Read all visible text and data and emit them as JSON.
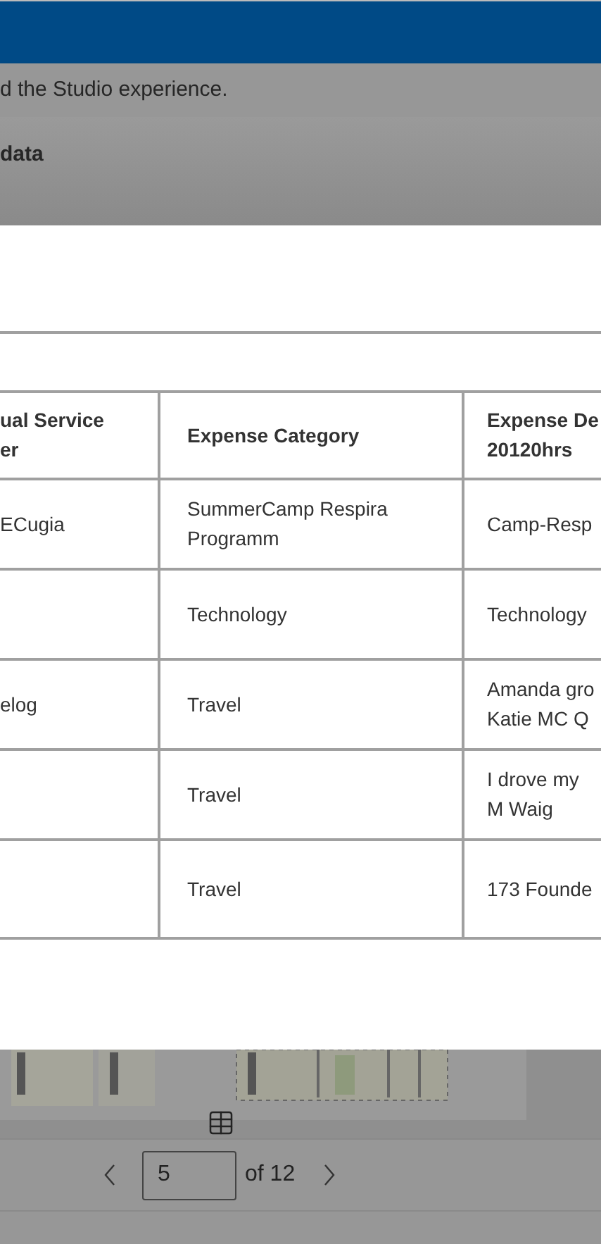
{
  "notice": {
    "text": "d the Studio experience."
  },
  "panel_header": {
    "title": "data"
  },
  "table": {
    "columns": [
      "ual Service\ner",
      "Expense Category",
      "Expense De\n20120hrs"
    ],
    "rows": [
      {
        "cells": [
          "ECugia",
          "SummerCamp Respira\nProgramm",
          "Camp-Resp"
        ]
      },
      {
        "cells": [
          "",
          "Technology",
          "Technology"
        ]
      },
      {
        "cells": [
          "elog",
          "Travel",
          "Amanda gro\nKatie MC Q"
        ]
      },
      {
        "cells": [
          "",
          "Travel",
          "I drove my\nM Waig"
        ]
      },
      {
        "cells": [
          "",
          "Travel",
          "173 Founde"
        ]
      }
    ]
  },
  "pager": {
    "page": "5",
    "of": "of 12"
  }
}
